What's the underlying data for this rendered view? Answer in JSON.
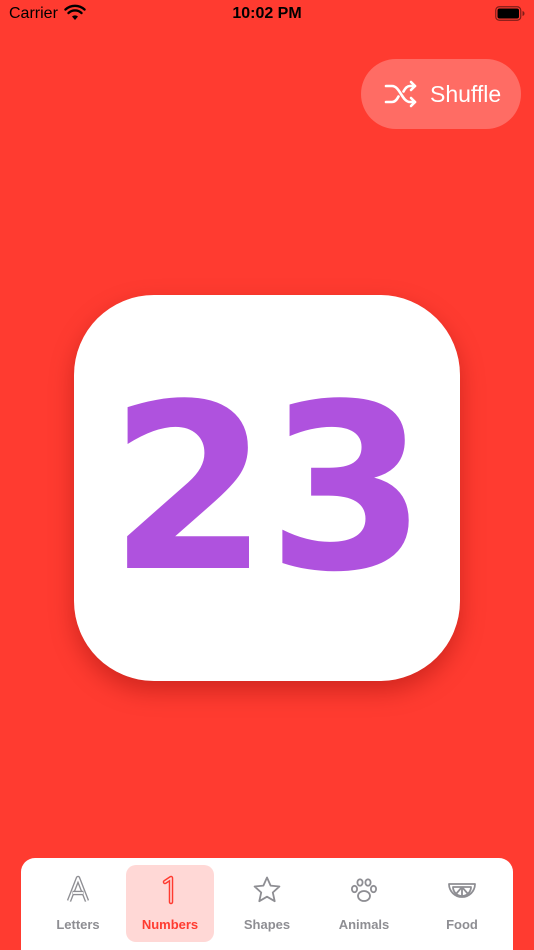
{
  "status_bar": {
    "carrier": "Carrier",
    "time": "10:02 PM"
  },
  "shuffle": {
    "label": "Shuffle",
    "icon": "shuffle-icon"
  },
  "card": {
    "value": "23",
    "color": "#AF52DE"
  },
  "theme": {
    "background": "#FF3B30",
    "active_tab_bg": "#FFD8D6",
    "inactive_color": "#8E8E93"
  },
  "tabs": [
    {
      "label": "Letters",
      "icon": "letter-a-icon",
      "active": false
    },
    {
      "label": "Numbers",
      "icon": "number-one-icon",
      "active": true
    },
    {
      "label": "Shapes",
      "icon": "star-icon",
      "active": false
    },
    {
      "label": "Animals",
      "icon": "paw-icon",
      "active": false
    },
    {
      "label": "Food",
      "icon": "fruit-slice-icon",
      "active": false
    }
  ]
}
